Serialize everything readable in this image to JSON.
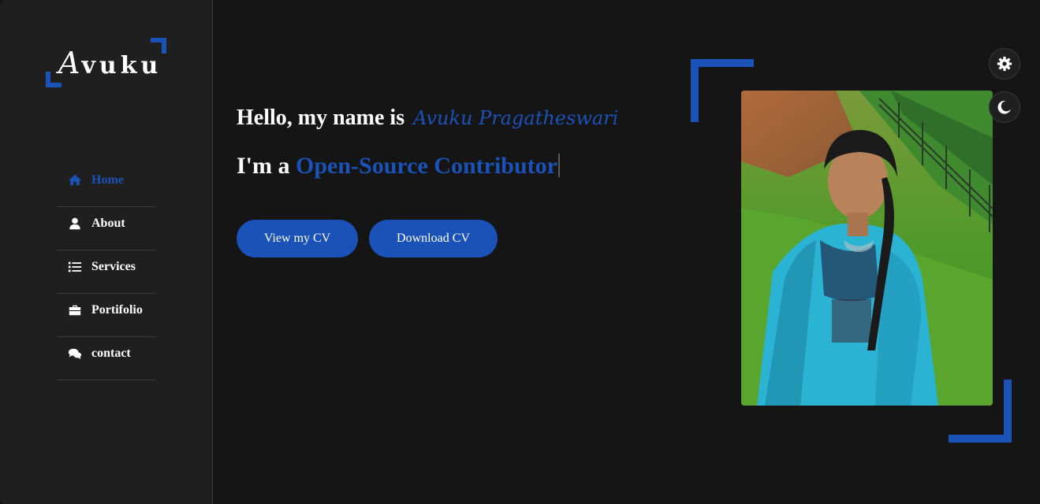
{
  "logo": {
    "initial": "A",
    "rest": "vuku"
  },
  "nav": {
    "items": [
      {
        "label": "Home",
        "icon": "home-icon",
        "active": true
      },
      {
        "label": "About",
        "icon": "user-icon",
        "active": false
      },
      {
        "label": "Services",
        "icon": "list-icon",
        "active": false
      },
      {
        "label": "Portifolio",
        "icon": "briefcase-icon",
        "active": false
      },
      {
        "label": "contact",
        "icon": "comments-icon",
        "active": false
      }
    ]
  },
  "hero": {
    "greeting": "Hello, my name is",
    "name": "Avuku Pragatheswari",
    "role_prefix": "I'm a",
    "role": "Open-Source Contributor",
    "view_cv_label": "View my CV",
    "download_cv_label": "Download CV"
  },
  "controls": {
    "settings_icon": "gear-icon",
    "theme_icon": "moon-icon"
  },
  "colors": {
    "accent": "#1a52b8",
    "background": "#151515",
    "sidebar": "#1f1f1f",
    "text": "#ffffff"
  }
}
